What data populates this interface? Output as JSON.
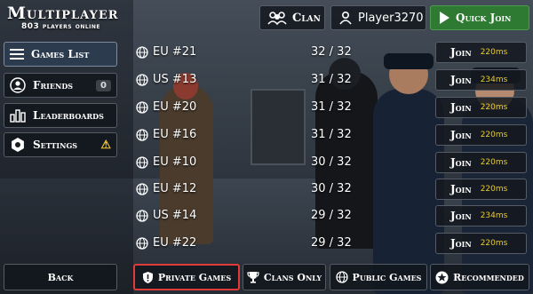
{
  "header": {
    "title": "Multiplayer",
    "subtitle": "803 players online",
    "clan_label": "Clan",
    "player_name": "Player3270",
    "quick_join_label": "Quick Join"
  },
  "menu": {
    "games_list": "Games List",
    "friends": "Friends",
    "friends_count": "0",
    "leaderboards": "Leaderboards",
    "settings": "Settings"
  },
  "servers": [
    {
      "name": "EU #21",
      "players": "32 / 32",
      "join": "Join",
      "ping": "220ms"
    },
    {
      "name": "US #13",
      "players": "31 / 32",
      "join": "Join",
      "ping": "234ms"
    },
    {
      "name": "EU #20",
      "players": "31 / 32",
      "join": "Join",
      "ping": "220ms"
    },
    {
      "name": "EU #16",
      "players": "31 / 32",
      "join": "Join",
      "ping": "220ms"
    },
    {
      "name": "EU #10",
      "players": "30 / 32",
      "join": "Join",
      "ping": "220ms"
    },
    {
      "name": "EU #12",
      "players": "30 / 32",
      "join": "Join",
      "ping": "220ms"
    },
    {
      "name": "US #14",
      "players": "29 / 32",
      "join": "Join",
      "ping": "234ms"
    },
    {
      "name": "EU #22",
      "players": "29 / 32",
      "join": "Join",
      "ping": "220ms"
    }
  ],
  "footer": {
    "back": "Back",
    "private_games": "Private Games",
    "clans_only": "Clans Only",
    "public_games": "Public Games",
    "recommended": "Recommended"
  },
  "colors": {
    "quick_join_bg": "#2f7a33",
    "ping": "#e8cc2e",
    "private_outline": "#e03a3a",
    "warning": "#f2c22b"
  }
}
